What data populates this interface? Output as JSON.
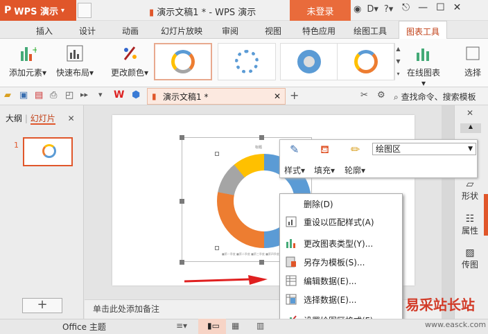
{
  "titlebar": {
    "app_label": "WPS 演示",
    "doc_title": "演示文稿1 * - WPS 演示",
    "login_label": "未登录"
  },
  "ribbon_tabs": [
    "插入",
    "设计",
    "动画",
    "幻灯片放映",
    "审阅",
    "视图",
    "特色应用",
    "绘图工具",
    "图表工具"
  ],
  "ribbon": {
    "add_element": "添加元素",
    "quick_layout": "快速布局",
    "change_color": "更改颜色",
    "online_chart": "在线图表",
    "select": "选择"
  },
  "quickbar": {
    "doc_tab": "演示文稿1 *",
    "search": "查找命令、搜索模板"
  },
  "left_panel": {
    "tab_outline": "大纲",
    "tab_slides": "幻灯片",
    "slide_number": "1"
  },
  "notes_placeholder": "单击此处添加备注",
  "chart": {
    "title": "标题",
    "legend": "■第一季度 ■第二季度 ■第三季度 ■第四季度"
  },
  "right_panel": {
    "shape": "形状",
    "property": "属性",
    "image": "传图"
  },
  "float_toolbar": {
    "style": "样式",
    "fill": "填充",
    "outline": "轮廓",
    "element_select": "绘图区"
  },
  "context_menu": [
    "删除(D)",
    "重设以匹配样式(A)",
    "更改图表类型(Y)...",
    "另存为模板(S)...",
    "编辑数据(E)...",
    "选择数据(E)...",
    "设置绘图区格式(F)..."
  ],
  "statusbar": {
    "theme": "Office 主题"
  },
  "watermark": {
    "text": "易采站长站",
    "url": "www.easck.com"
  },
  "colors": {
    "accent": "#e0562a",
    "donut_blue": "#5b9bd5",
    "donut_orange": "#ed7d31",
    "donut_gray": "#a5a5a5",
    "donut_yellow": "#ffc000",
    "arrow_red": "#e02020"
  }
}
